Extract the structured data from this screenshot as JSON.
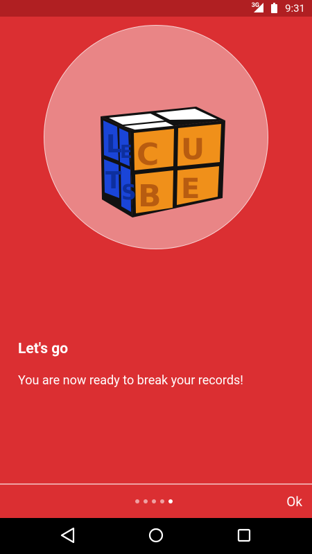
{
  "status_bar": {
    "network": "3G",
    "time": "9:31"
  },
  "intro": {
    "title": "Let's go",
    "description": "You are now ready to break your records!"
  },
  "pager": {
    "page_count": 5,
    "active_index": 4,
    "ok_label": "Ok"
  },
  "logo": {
    "name": "LET'S CUBE cube logo",
    "blue": "#1a45d8",
    "orange": "#f0901a",
    "letters_blue": [
      "L",
      "E",
      "T",
      "S"
    ],
    "letters_orange": [
      "C",
      "U",
      "B",
      "E"
    ]
  },
  "colors": {
    "background": "#db2f32",
    "status_bar": "#b01f22",
    "circle": "#e98586"
  },
  "nav_bar": {
    "icons": [
      "back-icon",
      "home-icon",
      "recents-icon"
    ]
  }
}
